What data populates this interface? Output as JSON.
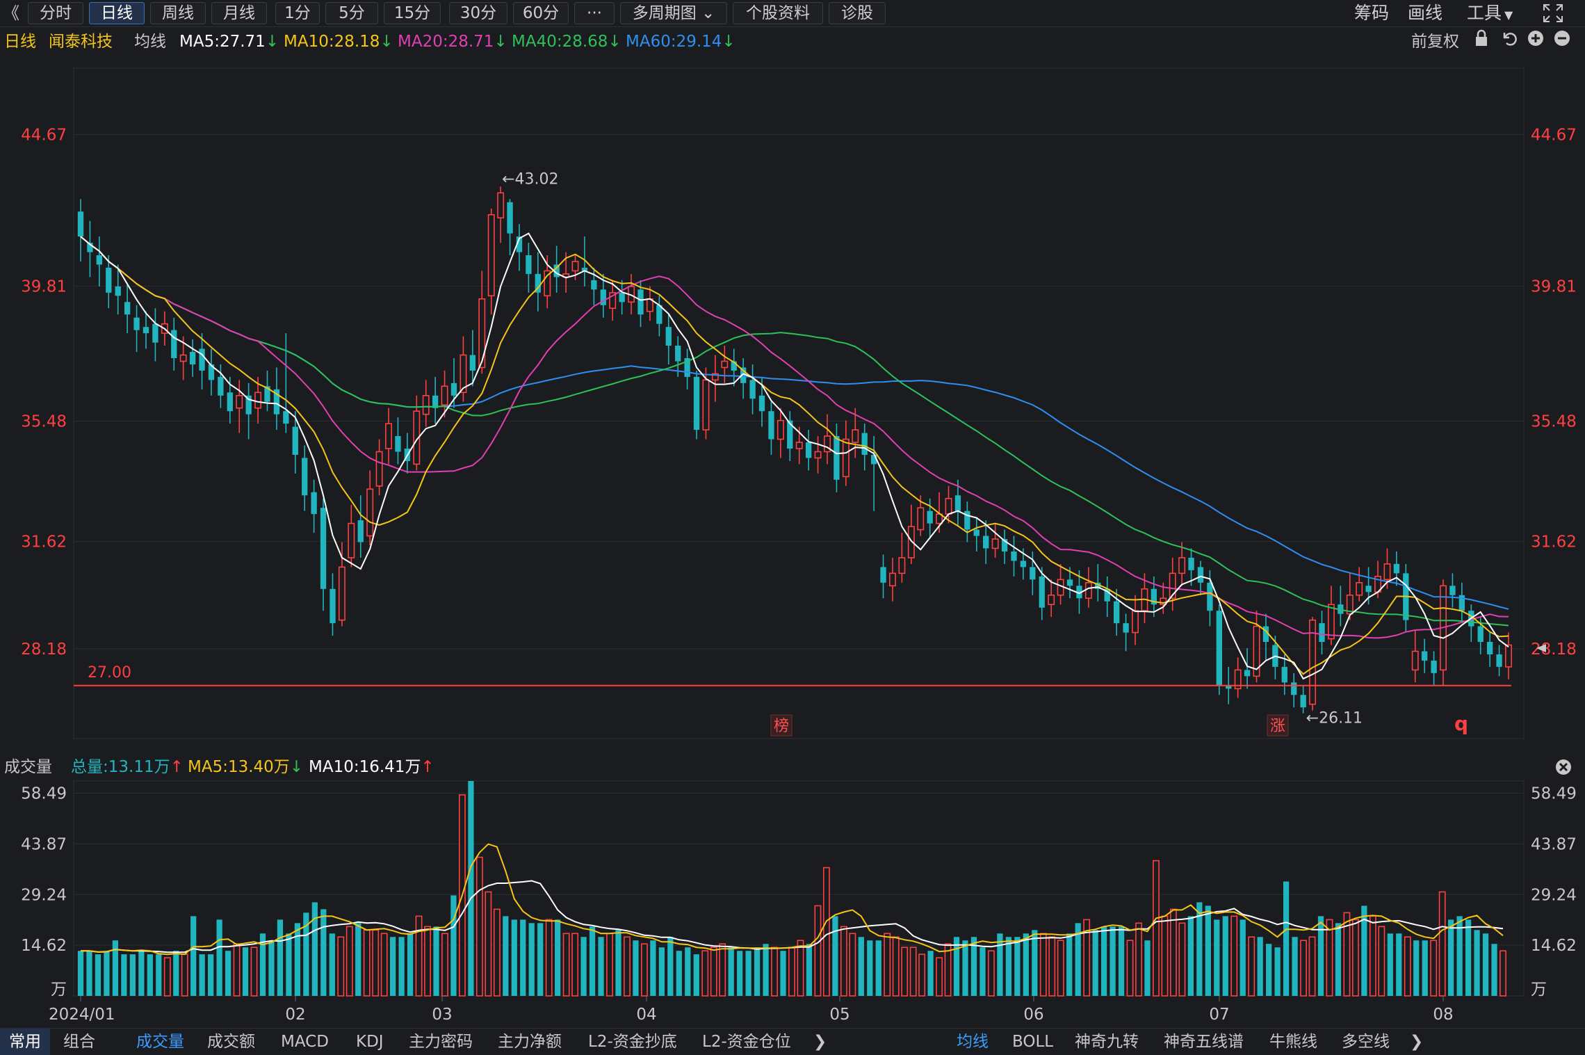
{
  "toolbar": {
    "back": "《",
    "tabs": [
      "分时",
      "日线",
      "周线",
      "月线",
      "1分",
      "5分",
      "15分",
      "30分",
      "60分",
      "···",
      "多周期图",
      "个股资料",
      "诊股"
    ],
    "active": "日线",
    "right": [
      "筹码",
      "画线",
      "工具"
    ]
  },
  "header": {
    "period": "日线",
    "stock": "闻泰科技",
    "ma_label": "均线",
    "ma5": "MA5:27.71",
    "ma10": "MA10:28.18",
    "ma20": "MA20:28.71",
    "ma40": "MA40:28.68",
    "ma60": "MA60:29.14",
    "fuquan": "前复权"
  },
  "colors": {
    "up": "#ff4040",
    "down": "#21b5bf",
    "ma5": "#ffffff",
    "ma10": "#f5c518",
    "ma20": "#e040b0",
    "ma40": "#2ec15a",
    "ma60": "#2e8ff0",
    "ref": "#ff4040"
  },
  "chart_data": [
    {
      "type": "candlestick",
      "y_ticks": [
        "44.67",
        "39.81",
        "35.48",
        "31.62",
        "28.18"
      ],
      "ylim": [
        25.3,
        46.8
      ],
      "ref_line": {
        "value": 27.0,
        "label": "27.00"
      },
      "annotations": {
        "high": "←43.02",
        "low": "←26.11"
      },
      "tags": [
        "榜",
        "涨",
        "q"
      ],
      "ohlc_desc": "Daily OHLC, 2024-01 to 2024-08 (estimated from chart)",
      "ohlc": [
        [
          42.2,
          41.4,
          42.6,
          40.6
        ],
        [
          41.2,
          40.9,
          41.9,
          40.1
        ],
        [
          40.8,
          40.5,
          41.4,
          39.8
        ],
        [
          40.4,
          39.6,
          40.8,
          39.1
        ],
        [
          39.8,
          39.5,
          40.5,
          38.9
        ],
        [
          39.3,
          38.9,
          39.9,
          38.3
        ],
        [
          38.8,
          38.4,
          39.2,
          37.7
        ],
        [
          38.5,
          38.3,
          39.0,
          37.8
        ],
        [
          38.6,
          38.0,
          39.1,
          37.4
        ],
        [
          38.3,
          38.6,
          39.0,
          37.9
        ],
        [
          38.4,
          37.5,
          38.8,
          37.1
        ],
        [
          37.4,
          37.6,
          38.2,
          36.8
        ],
        [
          37.7,
          37.3,
          38.1,
          36.9
        ],
        [
          37.8,
          37.1,
          38.3,
          36.5
        ],
        [
          37.3,
          36.8,
          37.8,
          36.3
        ],
        [
          36.9,
          36.3,
          37.3,
          35.9
        ],
        [
          36.4,
          35.8,
          36.9,
          35.4
        ],
        [
          35.9,
          36.3,
          36.8,
          35.1
        ],
        [
          36.3,
          35.7,
          36.7,
          34.9
        ],
        [
          35.9,
          36.4,
          36.9,
          35.4
        ],
        [
          36.6,
          36.1,
          37.1,
          35.8
        ],
        [
          36.5,
          35.7,
          37.2,
          35.2
        ],
        [
          35.8,
          35.4,
          38.3,
          35.1
        ],
        [
          35.3,
          34.4,
          35.8,
          33.8
        ],
        [
          34.3,
          33.1,
          34.7,
          32.6
        ],
        [
          33.2,
          32.5,
          33.6,
          31.9
        ],
        [
          32.7,
          30.1,
          33.0,
          29.4
        ],
        [
          30.1,
          29.0,
          30.6,
          28.6
        ],
        [
          29.1,
          30.8,
          31.6,
          28.9
        ],
        [
          31.1,
          32.2,
          32.8,
          30.8
        ],
        [
          32.3,
          31.6,
          33.1,
          31.1
        ],
        [
          31.8,
          33.3,
          33.9,
          31.5
        ],
        [
          33.4,
          34.5,
          34.9,
          33.1
        ],
        [
          34.6,
          35.4,
          35.9,
          34.1
        ],
        [
          35.0,
          34.5,
          35.6,
          34.1
        ],
        [
          34.6,
          34.2,
          35.1,
          33.8
        ],
        [
          34.1,
          35.8,
          36.3,
          33.9
        ],
        [
          35.7,
          36.3,
          36.8,
          35.3
        ],
        [
          36.3,
          35.9,
          36.9,
          35.4
        ],
        [
          36.0,
          36.6,
          37.1,
          35.6
        ],
        [
          36.7,
          36.3,
          37.5,
          35.9
        ],
        [
          36.4,
          37.6,
          38.2,
          36.1
        ],
        [
          37.6,
          37.1,
          38.4,
          36.6
        ],
        [
          37.2,
          39.4,
          40.3,
          37.0
        ],
        [
          39.5,
          42.1,
          42.3,
          38.9
        ],
        [
          42.0,
          42.8,
          43.0,
          41.2
        ],
        [
          42.5,
          41.5,
          42.6,
          40.8
        ],
        [
          41.4,
          40.9,
          41.8,
          40.3
        ],
        [
          40.8,
          40.2,
          41.2,
          39.6
        ],
        [
          40.2,
          39.6,
          40.9,
          39.0
        ],
        [
          39.5,
          40.3,
          40.8,
          39.1
        ],
        [
          40.5,
          40.1,
          41.1,
          39.6
        ],
        [
          40.1,
          40.2,
          40.9,
          39.6
        ],
        [
          40.3,
          40.6,
          40.8,
          40.0
        ],
        [
          40.4,
          40.3,
          41.4,
          39.8
        ],
        [
          40.0,
          39.7,
          40.4,
          39.2
        ],
        [
          39.7,
          39.2,
          40.2,
          38.8
        ],
        [
          39.1,
          39.6,
          40.0,
          38.7
        ],
        [
          39.6,
          39.3,
          40.0,
          38.9
        ],
        [
          39.3,
          39.8,
          40.2,
          38.9
        ],
        [
          39.7,
          38.9,
          40.0,
          38.5
        ],
        [
          39.0,
          39.4,
          39.8,
          38.7
        ],
        [
          39.2,
          38.6,
          39.5,
          38.2
        ],
        [
          38.5,
          37.9,
          38.9,
          37.3
        ],
        [
          37.9,
          37.4,
          38.2,
          36.9
        ],
        [
          37.5,
          36.9,
          37.8,
          36.5
        ],
        [
          36.9,
          35.2,
          37.1,
          34.9
        ],
        [
          35.2,
          36.8,
          37.2,
          34.9
        ],
        [
          36.8,
          37.0,
          37.6,
          36.1
        ],
        [
          37.2,
          37.4,
          37.9,
          36.7
        ],
        [
          37.4,
          37.1,
          37.8,
          36.6
        ],
        [
          37.2,
          36.7,
          37.5,
          36.2
        ],
        [
          36.8,
          36.2,
          37.3,
          35.7
        ],
        [
          36.3,
          35.8,
          36.9,
          35.3
        ],
        [
          35.8,
          34.9,
          36.1,
          34.4
        ],
        [
          34.9,
          35.5,
          35.9,
          34.3
        ],
        [
          35.5,
          34.6,
          35.8,
          34.2
        ],
        [
          34.6,
          34.8,
          35.3,
          34.1
        ],
        [
          34.8,
          34.3,
          35.2,
          33.9
        ],
        [
          34.3,
          34.5,
          35.0,
          33.8
        ],
        [
          34.5,
          35.0,
          35.7,
          34.1
        ],
        [
          35.0,
          33.6,
          35.4,
          33.2
        ],
        [
          33.7,
          34.9,
          35.5,
          33.4
        ],
        [
          34.8,
          35.2,
          35.9,
          34.3
        ],
        [
          35.1,
          34.4,
          35.4,
          33.9
        ],
        [
          34.4,
          34.1,
          35.0,
          32.6
        ],
        [
          30.8,
          30.3,
          31.2,
          29.8
        ],
        [
          30.2,
          30.6,
          31.1,
          29.7
        ],
        [
          30.6,
          31.1,
          31.9,
          30.3
        ],
        [
          31.1,
          32.1,
          32.8,
          30.9
        ],
        [
          32.0,
          32.7,
          33.1,
          31.8
        ],
        [
          32.6,
          32.2,
          33.0,
          31.7
        ],
        [
          32.2,
          32.5,
          33.2,
          31.9
        ],
        [
          32.5,
          33.0,
          33.4,
          32.2
        ],
        [
          33.1,
          32.6,
          33.6,
          32.1
        ],
        [
          32.6,
          32.0,
          32.9,
          31.6
        ],
        [
          32.0,
          31.8,
          32.4,
          31.3
        ],
        [
          31.8,
          31.4,
          32.3,
          30.9
        ],
        [
          31.4,
          31.7,
          32.2,
          31.1
        ],
        [
          31.7,
          31.3,
          32.0,
          30.9
        ],
        [
          31.3,
          31.0,
          31.8,
          30.5
        ],
        [
          31.0,
          30.8,
          31.4,
          30.4
        ],
        [
          30.8,
          30.4,
          31.3,
          29.9
        ],
        [
          30.5,
          29.5,
          30.8,
          29.1
        ],
        [
          29.6,
          29.9,
          30.4,
          29.2
        ],
        [
          29.9,
          30.4,
          30.9,
          29.6
        ],
        [
          30.4,
          30.2,
          30.8,
          29.8
        ],
        [
          30.2,
          29.8,
          30.7,
          29.3
        ],
        [
          29.8,
          30.3,
          30.8,
          29.5
        ],
        [
          30.3,
          30.1,
          30.9,
          29.7
        ],
        [
          30.1,
          29.7,
          30.5,
          29.2
        ],
        [
          29.7,
          29.0,
          30.1,
          28.6
        ],
        [
          29.0,
          28.7,
          29.3,
          28.1
        ],
        [
          28.7,
          29.4,
          29.9,
          28.3
        ],
        [
          29.4,
          30.1,
          30.6,
          29.0
        ],
        [
          30.1,
          29.6,
          30.5,
          29.2
        ],
        [
          29.6,
          29.8,
          30.3,
          29.3
        ],
        [
          29.8,
          30.6,
          31.1,
          29.4
        ],
        [
          30.6,
          31.1,
          31.6,
          30.2
        ],
        [
          31.1,
          30.7,
          31.4,
          30.2
        ],
        [
          30.8,
          30.3,
          31.0,
          29.9
        ],
        [
          30.3,
          29.4,
          30.7,
          28.9
        ],
        [
          29.4,
          27.0,
          29.6,
          26.7
        ],
        [
          27.0,
          26.9,
          27.6,
          26.4
        ],
        [
          26.9,
          27.5,
          27.9,
          26.6
        ],
        [
          27.5,
          27.3,
          28.2,
          26.9
        ],
        [
          27.3,
          28.9,
          29.4,
          27.1
        ],
        [
          28.9,
          28.4,
          29.3,
          27.8
        ],
        [
          28.3,
          27.6,
          28.6,
          27.2
        ],
        [
          27.6,
          27.1,
          28.0,
          26.7
        ],
        [
          27.1,
          26.7,
          27.4,
          26.3
        ],
        [
          26.7,
          26.3,
          27.0,
          26.11
        ],
        [
          26.4,
          29.1,
          29.2,
          26.2
        ],
        [
          29.0,
          28.4,
          29.4,
          28.0
        ],
        [
          28.5,
          29.6,
          30.2,
          28.3
        ],
        [
          29.6,
          29.3,
          30.2,
          28.9
        ],
        [
          29.3,
          29.9,
          30.6,
          29.1
        ],
        [
          29.9,
          30.3,
          30.8,
          29.7
        ],
        [
          30.2,
          30.0,
          30.8,
          29.6
        ],
        [
          30.0,
          30.5,
          31.0,
          29.8
        ],
        [
          30.4,
          30.9,
          31.4,
          30.1
        ],
        [
          30.9,
          30.6,
          31.3,
          30.2
        ],
        [
          30.6,
          29.1,
          30.9,
          28.7
        ],
        [
          27.5,
          28.1,
          28.8,
          27.1
        ],
        [
          28.1,
          27.8,
          28.5,
          27.4
        ],
        [
          27.8,
          27.4,
          28.1,
          27.0
        ],
        [
          27.5,
          30.2,
          30.4,
          27.0
        ],
        [
          30.2,
          29.9,
          30.6,
          29.5
        ],
        [
          29.9,
          29.4,
          30.3,
          29.0
        ],
        [
          29.4,
          28.9,
          29.6,
          28.4
        ],
        [
          28.9,
          28.4,
          29.2,
          28.0
        ],
        [
          28.4,
          28.0,
          28.7,
          27.6
        ],
        [
          28.0,
          27.6,
          28.3,
          27.3
        ],
        [
          27.6,
          28.3,
          28.7,
          27.2
        ]
      ]
    },
    {
      "type": "bar",
      "title": "成交量",
      "unit": "万",
      "y_ticks": [
        "58.49",
        "43.87",
        "29.24",
        "14.62",
        "万"
      ],
      "ylim": [
        0,
        62
      ],
      "x_ticks": [
        "2024/01",
        "02",
        "03",
        "04",
        "05",
        "06",
        "07",
        "08"
      ],
      "total": "总量:13.11万",
      "ma5": "MA5:13.40万",
      "ma10": "MA10:16.41万",
      "volumes": [
        13,
        13,
        12,
        13,
        16,
        12,
        12,
        13,
        12,
        12,
        11,
        13,
        12,
        23,
        12,
        12,
        22,
        13,
        15,
        14,
        14,
        18,
        16,
        22,
        18,
        21,
        24,
        27,
        25,
        18,
        17,
        20,
        21,
        19,
        19,
        18,
        17,
        17,
        18,
        23,
        20,
        20,
        18,
        29,
        58,
        62,
        40,
        30,
        25,
        23,
        22,
        22,
        21,
        21,
        22,
        22,
        18,
        18,
        17,
        20,
        17,
        18,
        19,
        17,
        16,
        15,
        16,
        14,
        17,
        13,
        14,
        12,
        13,
        14,
        15,
        14,
        13,
        13,
        14,
        15,
        14,
        13,
        14,
        16,
        15,
        26,
        37,
        23,
        20,
        18,
        17,
        16,
        16,
        18,
        17,
        14,
        14,
        12,
        13,
        11,
        15,
        17,
        16,
        17,
        14,
        13,
        18,
        17,
        17,
        18,
        19,
        18,
        17,
        16,
        18,
        21,
        22,
        19,
        20,
        20,
        20,
        16,
        21,
        16,
        39,
        23,
        25,
        21,
        23,
        27,
        26,
        22,
        23,
        23,
        22,
        17,
        17,
        15,
        14,
        33,
        17,
        16,
        17,
        23,
        22,
        21,
        24,
        22,
        26,
        23,
        20,
        18,
        18,
        17,
        16,
        16,
        16,
        30,
        22,
        23,
        22,
        19,
        18,
        15,
        13
      ],
      "vol_up_flags": "alternating"
    }
  ],
  "indicator_tabs": {
    "left": [
      "常用",
      "组合"
    ],
    "main": [
      "成交量",
      "成交额",
      "MACD",
      "KDJ",
      "主力密码",
      "主力净额",
      "L2-资金抄底",
      "L2-资金仓位"
    ],
    "right": [
      "均线",
      "BOLL",
      "神奇九转",
      "神奇五线谱",
      "牛熊线",
      "多空线"
    ]
  }
}
